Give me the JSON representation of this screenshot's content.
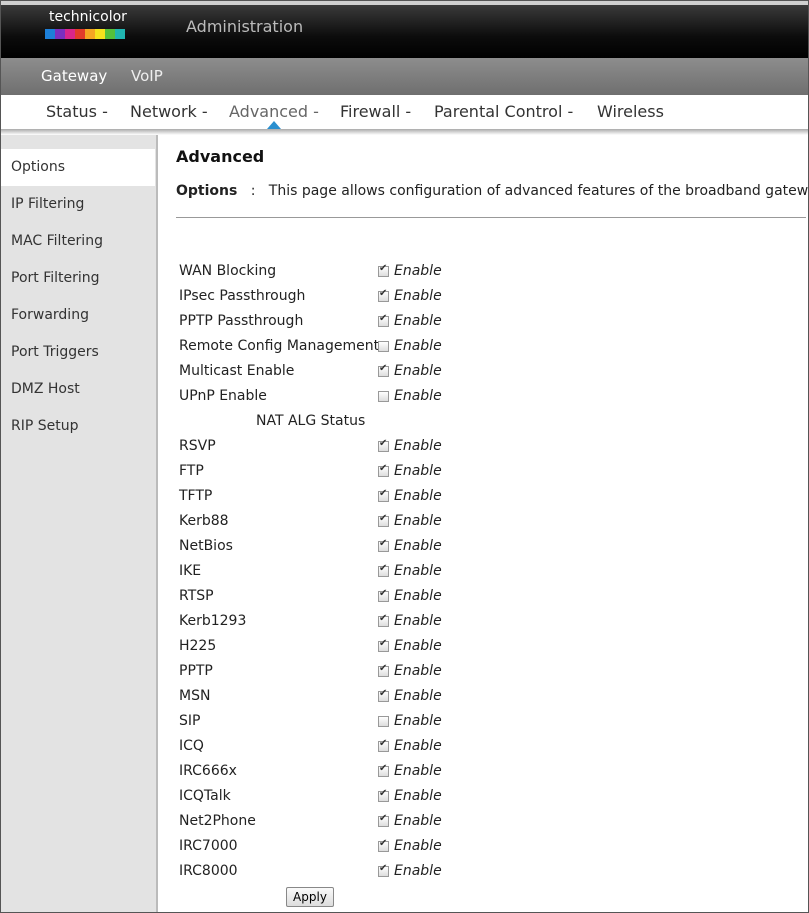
{
  "brand": {
    "logo_text": "technicolor"
  },
  "header": {
    "title": "Administration"
  },
  "nav1": {
    "items": [
      "Gateway",
      "VoIP"
    ]
  },
  "nav2": {
    "items": [
      "Status -",
      "Network -",
      "Advanced -",
      "Firewall -",
      "Parental Control -",
      "Wireless"
    ],
    "active": "Advanced -"
  },
  "sidebar": {
    "items": [
      "Options",
      "IP Filtering",
      "MAC Filtering",
      "Port Filtering",
      "Forwarding",
      "Port Triggers",
      "DMZ Host",
      "RIP Setup"
    ],
    "active": "Options"
  },
  "main": {
    "title": "Advanced",
    "desc_label": "Options",
    "desc_sep": ":",
    "desc_text": "This page allows configuration of advanced features of the broadband gateway.",
    "enable_label": "Enable",
    "nat_title": "NAT ALG Status",
    "apply_label": "Apply"
  },
  "settings": [
    {
      "label": "WAN Blocking",
      "checked": true
    },
    {
      "label": "IPsec Passthrough",
      "checked": true
    },
    {
      "label": "PPTP Passthrough",
      "checked": true
    },
    {
      "label": "Remote Config Management",
      "checked": false
    },
    {
      "label": "Multicast Enable",
      "checked": true
    },
    {
      "label": "UPnP Enable",
      "checked": false
    }
  ],
  "nat_alg": [
    {
      "label": "RSVP",
      "checked": true
    },
    {
      "label": "FTP",
      "checked": true
    },
    {
      "label": "TFTP",
      "checked": true
    },
    {
      "label": "Kerb88",
      "checked": true
    },
    {
      "label": "NetBios",
      "checked": true
    },
    {
      "label": "IKE",
      "checked": true
    },
    {
      "label": "RTSP",
      "checked": true
    },
    {
      "label": "Kerb1293",
      "checked": true
    },
    {
      "label": "H225",
      "checked": true
    },
    {
      "label": "PPTP",
      "checked": true
    },
    {
      "label": "MSN",
      "checked": true
    },
    {
      "label": "SIP",
      "checked": false
    },
    {
      "label": "ICQ",
      "checked": true
    },
    {
      "label": "IRC666x",
      "checked": true
    },
    {
      "label": "ICQTalk",
      "checked": true
    },
    {
      "label": "Net2Phone",
      "checked": true
    },
    {
      "label": "IRC7000",
      "checked": true
    },
    {
      "label": "IRC8000",
      "checked": true
    }
  ]
}
